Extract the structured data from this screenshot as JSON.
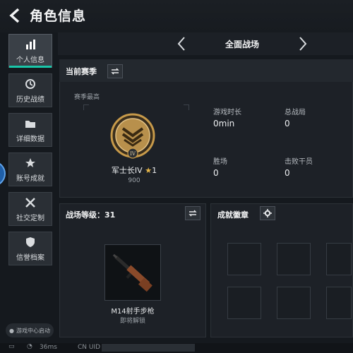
{
  "header": {
    "title": "角色信息"
  },
  "sidebar": {
    "items": [
      {
        "label": "个人信息",
        "icon": "bar-chart-icon",
        "active": true
      },
      {
        "label": "历史战绩",
        "icon": "history-clock-icon"
      },
      {
        "label": "详细数据",
        "icon": "folder-icon"
      },
      {
        "label": "账号成就",
        "icon": "achievement-icon"
      },
      {
        "label": "社交定制",
        "icon": "tools-icon"
      },
      {
        "label": "信誉档案",
        "icon": "credit-shield-icon"
      }
    ],
    "launch_badge": "游戏中心启动"
  },
  "mode": {
    "label": "全面战场"
  },
  "season": {
    "title": "当前赛季",
    "best_label": "赛季最高",
    "rank_name": "军士长IV",
    "rank_stars": "1",
    "rank_score": "900",
    "rank_emblem_numeral": "IV"
  },
  "stats": [
    {
      "label": "游戏时长",
      "value": "0min"
    },
    {
      "label": "总战局",
      "value": "0"
    },
    {
      "label": "胜场",
      "value": "0"
    },
    {
      "label": "击败干员",
      "value": "0"
    }
  ],
  "level": {
    "title": "战场等级：",
    "value": "31",
    "weapon_name": "M14射手步枪",
    "weapon_status": "即将解锁"
  },
  "badges": {
    "title": "成就徽章"
  },
  "status_bar": {
    "ping": "36ms",
    "uid_label": "CN UID"
  },
  "colors": {
    "accent": "#19c6a9",
    "gold": "#c79a4a",
    "star": "#e8b84a"
  }
}
